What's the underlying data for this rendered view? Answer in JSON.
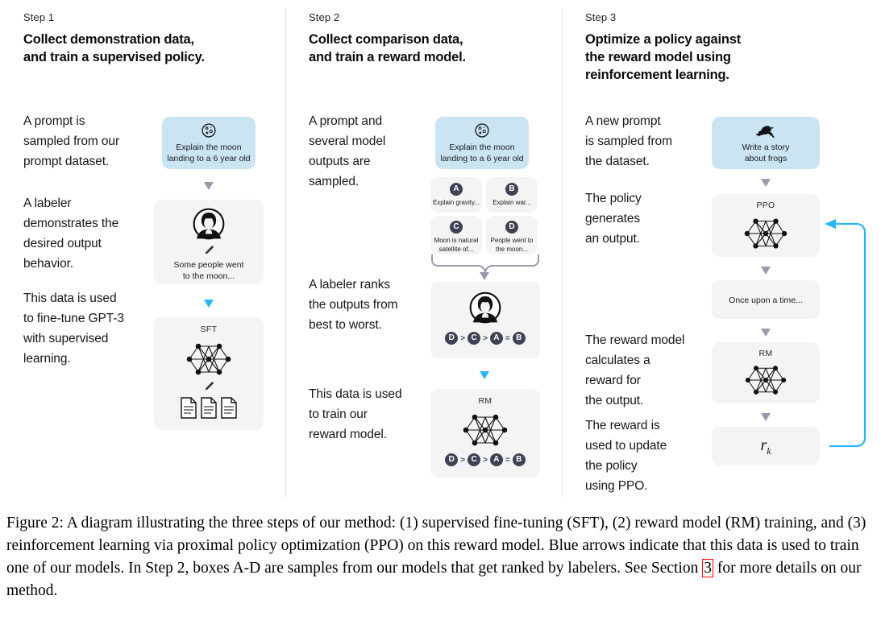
{
  "figure": {
    "columns": [
      {
        "step_label": "Step 1",
        "title_line1": "Collect demonstration data,",
        "title_line2": "and train a supervised policy.",
        "texts": [
          "A prompt is\nsampled from our\nprompt dataset.",
          "A labeler\ndemonstrates the\ndesired output\nbehavior.",
          "This data is used\nto fine-tune GPT-3\nwith supervised\nlearning."
        ],
        "cards": {
          "prompt": {
            "icon": "moon-icon",
            "caption": "Explain the moon\nlanding to a 6 year old",
            "color": "#cbe4f2"
          },
          "demo": {
            "icon": "labeler-icon",
            "caption": "Some people went\nto the moon..."
          },
          "sft": {
            "title": "SFT",
            "icon": "neural-net-icon"
          }
        }
      },
      {
        "step_label": "Step 2",
        "title_line1": "Collect comparison data,",
        "title_line2": "and train a reward model.",
        "texts": [
          "A prompt and\nseveral model\noutputs are\nsampled.",
          "A labeler ranks\nthe outputs from\nbest to worst.",
          "This data is used\nto train our\nreward model."
        ],
        "cards": {
          "prompt": {
            "icon": "moon-icon",
            "caption": "Explain the moon\nlanding to a 6 year old",
            "color": "#cbe4f2"
          },
          "samples": [
            {
              "badge": "A",
              "caption": "Explain gravity..."
            },
            {
              "badge": "B",
              "caption": "Explain war..."
            },
            {
              "badge": "C",
              "caption": "Moon is natural\nsatellite of..."
            },
            {
              "badge": "D",
              "caption": "People went to\nthe moon..."
            }
          ],
          "ranking": {
            "icon": "labeler-icon",
            "order": [
              "D",
              "C",
              "A",
              "B"
            ],
            "operators": [
              ">",
              ">",
              "="
            ]
          },
          "rm": {
            "title": "RM",
            "icon": "neural-net-icon",
            "order": [
              "D",
              "C",
              "A",
              "B"
            ],
            "operators": [
              ">",
              ">",
              "="
            ]
          }
        }
      },
      {
        "step_label": "Step 3",
        "title_line1": "Optimize a policy against",
        "title_line2": "the reward model using",
        "title_line3": "reinforcement learning.",
        "texts": [
          "A new prompt\nis sampled from\nthe dataset.",
          "The policy\ngenerates\nan output.",
          "The reward model\ncalculates a\nreward for\nthe output.",
          "The reward is\nused to update\nthe policy\nusing PPO."
        ],
        "cards": {
          "prompt": {
            "icon": "frog-icon",
            "caption": "Write a story\nabout frogs",
            "color": "#cbe4f2"
          },
          "ppo": {
            "title": "PPO",
            "icon": "neural-net-icon"
          },
          "output": {
            "caption": "Once upon a time..."
          },
          "rm": {
            "title": "RM",
            "icon": "neural-net-icon"
          },
          "reward": {
            "value": "r",
            "subscript": "k"
          }
        }
      }
    ],
    "colors": {
      "prompt_card": "#cbe4f2",
      "card": "#f4f4f5",
      "arrow": "#9a9aad",
      "blue_arrow": "#29b6f6",
      "badge": "#3f4254",
      "link_box": "#ff0000"
    }
  },
  "caption": {
    "part1": "Figure 2: A diagram illustrating the three steps of our method: (1) supervised fine-tuning (SFT), (2) reward model (RM) training, and (3) reinforcement learning via proximal policy optimization (PPO) on this reward model. Blue arrows indicate that this data is used to train one of our models. In Step 2, boxes A-D are samples from our models that get ranked by labelers. See Section ",
    "link": "3",
    "part2": " for more details on our method."
  }
}
